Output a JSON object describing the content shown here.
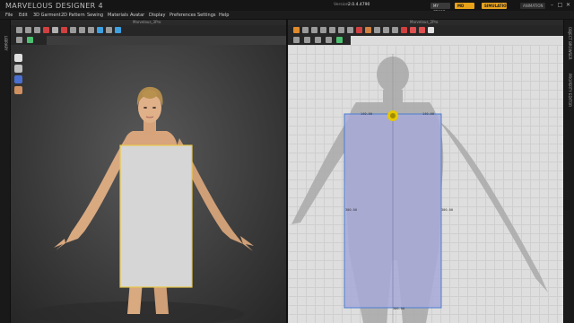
{
  "app": {
    "title": "MARVELOUS DESIGNER 4",
    "version_label": "Version",
    "version": "2.0.4.4790"
  },
  "topbar": {
    "my_store": "MY STORE",
    "md_store": "MD STORE",
    "simulation": "SIMULATION",
    "animation": "ANIMATION"
  },
  "window_controls": [
    "–",
    "□",
    "✕"
  ],
  "menu": [
    "File",
    "Edit",
    "3D Garment",
    "2D Pattern",
    "Sewing",
    "Materials",
    "Avatar",
    "Display",
    "Preferences",
    "Settings",
    "Help"
  ],
  "left_strip": {
    "label": "LIBRARY"
  },
  "right_strip": {
    "labels": [
      "OBJECT BROWSER",
      "PROPERTY EDITOR"
    ]
  },
  "panel3d": {
    "title": "Marvelous_3Pro",
    "tools": [
      {
        "icon": "select-icon",
        "color": "#9a9a9a"
      },
      {
        "icon": "move-icon",
        "color": "#9a9a9a"
      },
      {
        "icon": "fold-icon",
        "color": "#9a9a9a"
      },
      {
        "icon": "pin-icon",
        "color": "#d04040"
      },
      {
        "icon": "tape-icon",
        "color": "#b0b0b0"
      },
      {
        "icon": "brush-icon",
        "color": "#d04040"
      },
      {
        "icon": "edit-pattern-icon",
        "color": "#9a9a9a"
      },
      {
        "icon": "edit-point-icon",
        "color": "#9a9a9a"
      },
      {
        "icon": "segment-sewing-icon",
        "color": "#9a9a9a"
      },
      {
        "icon": "shirt-icon",
        "color": "#3ea0e0"
      },
      {
        "icon": "texture-icon",
        "color": "#9a9a9a"
      },
      {
        "icon": "avatar-view-icon",
        "color": "#3ea0e0"
      }
    ],
    "sub_tools": [
      {
        "icon": "play-icon",
        "color": "#9a9a9a"
      },
      {
        "icon": "grid-icon",
        "color": "#4cc070"
      }
    ],
    "side_icons": [
      {
        "icon": "garment-icon",
        "color": "#e0e0e0"
      },
      {
        "icon": "avatar-icon",
        "color": "#c0c0c0"
      },
      {
        "icon": "magnet-icon",
        "color": "#4a6fd0"
      },
      {
        "icon": "face-icon",
        "color": "#d09060"
      }
    ]
  },
  "panel2d": {
    "title": "Marvelous_2Pro",
    "tools": [
      {
        "icon": "rotate-icon",
        "color": "#e08a2a"
      },
      {
        "icon": "select-icon",
        "color": "#9a9a9a"
      },
      {
        "icon": "transform-icon",
        "color": "#9a9a9a"
      },
      {
        "icon": "edit-point-icon",
        "color": "#9a9a9a"
      },
      {
        "icon": "curve-icon",
        "color": "#9a9a9a"
      },
      {
        "icon": "rectangle-icon",
        "color": "#9a9a9a"
      },
      {
        "icon": "polygon-icon",
        "color": "#9a9a9a"
      },
      {
        "icon": "pencil-icon",
        "color": "#d04040"
      },
      {
        "icon": "scissors-icon",
        "color": "#d08040"
      },
      {
        "icon": "circle-icon",
        "color": "#9a9a9a"
      },
      {
        "icon": "dart-icon",
        "color": "#9a9a9a"
      },
      {
        "icon": "tuck-icon",
        "color": "#9a9a9a"
      },
      {
        "icon": "fabric-icon",
        "color": "#d04040"
      },
      {
        "icon": "button-icon",
        "color": "#e05050"
      },
      {
        "icon": "zipper-icon",
        "color": "#e05050"
      },
      {
        "icon": "pattern-icon",
        "color": "#e0e0e0"
      }
    ],
    "sub_tools": [
      {
        "icon": "play-icon",
        "color": "#9a9a9a"
      },
      {
        "icon": "trace-icon",
        "color": "#9a9a9a"
      },
      {
        "icon": "offset-icon",
        "color": "#9a9a9a"
      },
      {
        "icon": "arrange-icon",
        "color": "#9a9a9a"
      },
      {
        "icon": "grid-icon",
        "color": "#4cc070"
      }
    ],
    "dimensions": {
      "top_left": "140.00",
      "top_right": "140.00",
      "left": "300.00",
      "right": "300.00",
      "bottom": "300.00"
    }
  },
  "colors": {
    "accent": "#e8a21a",
    "pattern_outline": "#e8c84a",
    "pattern_2d": "#a7a9d8",
    "pattern_2d_outline": "#4a7ed0"
  }
}
